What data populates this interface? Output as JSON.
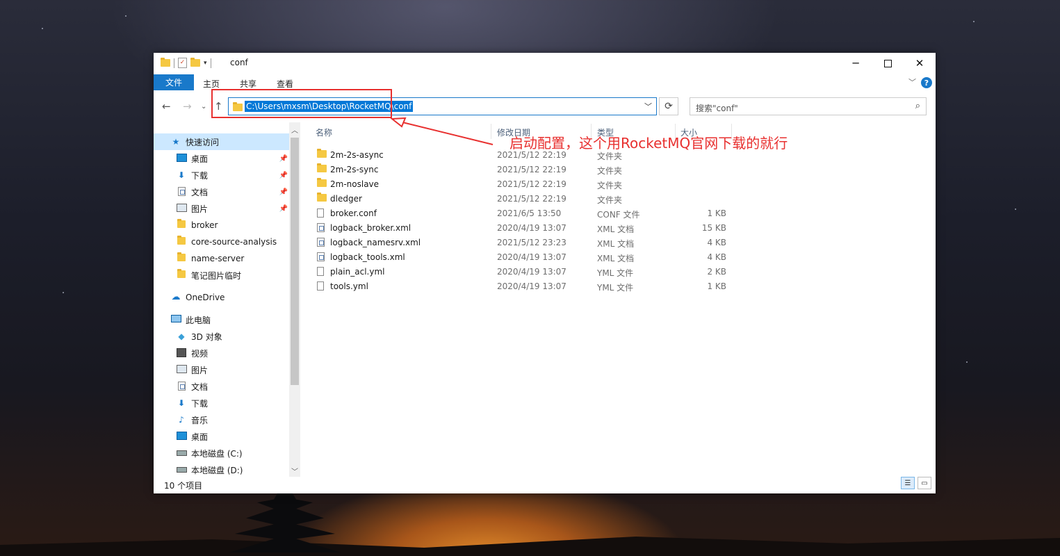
{
  "window": {
    "title": "conf"
  },
  "ribbon": {
    "tabs": [
      "文件",
      "主页",
      "共享",
      "查看"
    ],
    "help": "?"
  },
  "address": {
    "path": "C:\\Users\\mxsm\\Desktop\\RocketMQ\\conf"
  },
  "search": {
    "placeholder": "搜索\"conf\""
  },
  "annotation": {
    "text": "启动配置，这个用RocketMQ官网下载的就行",
    "color": "#e8302f"
  },
  "nav": {
    "quick_access": "快速访问",
    "pinned": [
      "桌面",
      "下载",
      "文档",
      "图片"
    ],
    "folders": [
      "broker",
      "core-source-analysis",
      "name-server",
      "笔记图片临时"
    ],
    "onedrive": "OneDrive",
    "this_pc": "此电脑",
    "pc_items": [
      "3D 对象",
      "视频",
      "图片",
      "文档",
      "下载",
      "音乐",
      "桌面",
      "本地磁盘 (C:)",
      "本地磁盘 (D:)"
    ]
  },
  "columns": {
    "name": "名称",
    "date": "修改日期",
    "type": "类型",
    "size": "大小"
  },
  "files": [
    {
      "name": "2m-2s-async",
      "date": "2021/5/12 22:19",
      "type": "文件夹",
      "size": "",
      "icon": "folder"
    },
    {
      "name": "2m-2s-sync",
      "date": "2021/5/12 22:19",
      "type": "文件夹",
      "size": "",
      "icon": "folder"
    },
    {
      "name": "2m-noslave",
      "date": "2021/5/12 22:19",
      "type": "文件夹",
      "size": "",
      "icon": "folder"
    },
    {
      "name": "dledger",
      "date": "2021/5/12 22:19",
      "type": "文件夹",
      "size": "",
      "icon": "folder"
    },
    {
      "name": "broker.conf",
      "date": "2021/6/5 13:50",
      "type": "CONF 文件",
      "size": "1 KB",
      "icon": "file"
    },
    {
      "name": "logback_broker.xml",
      "date": "2020/4/19 13:07",
      "type": "XML 文档",
      "size": "15 KB",
      "icon": "xml"
    },
    {
      "name": "logback_namesrv.xml",
      "date": "2021/5/12 23:23",
      "type": "XML 文档",
      "size": "4 KB",
      "icon": "xml"
    },
    {
      "name": "logback_tools.xml",
      "date": "2020/4/19 13:07",
      "type": "XML 文档",
      "size": "4 KB",
      "icon": "xml"
    },
    {
      "name": "plain_acl.yml",
      "date": "2020/4/19 13:07",
      "type": "YML 文件",
      "size": "2 KB",
      "icon": "file"
    },
    {
      "name": "tools.yml",
      "date": "2020/4/19 13:07",
      "type": "YML 文件",
      "size": "1 KB",
      "icon": "file"
    }
  ],
  "status": {
    "count": "10 个项目"
  },
  "colors": {
    "accent": "#1979ca",
    "selection": "#0078d7",
    "folder": "#f5c842"
  }
}
